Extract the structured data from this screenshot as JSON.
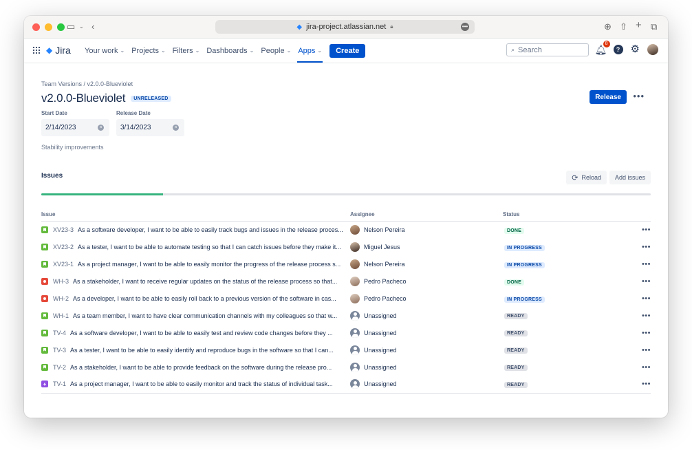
{
  "browser": {
    "url": "jira-project.atlassian.net",
    "lock_icon": "lock-icon"
  },
  "nav": {
    "logo": "Jira",
    "items": [
      {
        "label": "Your work",
        "caret": true
      },
      {
        "label": "Projects",
        "caret": true
      },
      {
        "label": "Filters",
        "caret": true
      },
      {
        "label": "Dashboards",
        "caret": true
      },
      {
        "label": "People",
        "caret": true
      },
      {
        "label": "Apps",
        "caret": true,
        "active": true
      }
    ],
    "create_label": "Create",
    "search_placeholder": "Search",
    "notifications_count": "8"
  },
  "page": {
    "breadcrumb": "Team Versions  /  v2.0.0-Blueviolet",
    "title": "v2.0.0-Blueviolet",
    "release_status": "UNRELEASED",
    "release_button": "Release",
    "start_date_label": "Start Date",
    "start_date": "2/14/2023",
    "release_date_label": "Release Date",
    "release_date": "3/14/2023",
    "description": "Stability improvements",
    "issues_heading": "Issues",
    "reload_label": "Reload",
    "add_issues_label": "Add issues",
    "progress_done_fraction": 0.2
  },
  "table": {
    "headers": {
      "issue": "Issue",
      "assignee": "Assignee",
      "status": "Status"
    },
    "rows": [
      {
        "type": "story",
        "key": "XV23-3",
        "summary": "As a software developer, I want to be able to easily track bugs and issues in the release proces...",
        "assignee": "Nelson Pereira",
        "avatar": "photo-a",
        "status": "DONE",
        "status_kind": "done"
      },
      {
        "type": "story",
        "key": "XV23-2",
        "summary": "As a tester, I want to be able to automate testing so that I can catch issues before they make it...",
        "assignee": "Miguel Jesus",
        "avatar": "photo-b",
        "status": "IN PROGRESS",
        "status_kind": "progress"
      },
      {
        "type": "story",
        "key": "XV23-1",
        "summary": "As a project manager, I want to be able to easily monitor the progress of the release process s...",
        "assignee": "Nelson Pereira",
        "avatar": "photo-a",
        "status": "IN PROGRESS",
        "status_kind": "progress"
      },
      {
        "type": "bug",
        "key": "WH-3",
        "summary": "As a stakeholder, I want to receive regular updates on the status of the release process so that...",
        "assignee": "Pedro Pacheco",
        "avatar": "photo-c",
        "status": "DONE",
        "status_kind": "done"
      },
      {
        "type": "bug",
        "key": "WH-2",
        "summary": "As a developer, I want to be able to easily roll back to a previous version of the software in cas...",
        "assignee": "Pedro Pacheco",
        "avatar": "photo-c",
        "status": "IN PROGRESS",
        "status_kind": "progress"
      },
      {
        "type": "story",
        "key": "WH-1",
        "summary": "As a team member, I want to have clear communication channels with my colleagues so that w...",
        "assignee": "Unassigned",
        "avatar": "empty",
        "status": "READY",
        "status_kind": "ready"
      },
      {
        "type": "story",
        "key": "TV-4",
        "summary": "As a software developer, I want to be able to easily test and review code changes before they ...",
        "assignee": "Unassigned",
        "avatar": "empty",
        "status": "READY",
        "status_kind": "ready"
      },
      {
        "type": "story",
        "key": "TV-3",
        "summary": "As a tester, I want to be able to easily identify and reproduce bugs in the software so that I can...",
        "assignee": "Unassigned",
        "avatar": "empty",
        "status": "READY",
        "status_kind": "ready"
      },
      {
        "type": "story",
        "key": "TV-2",
        "summary": "As a stakeholder, I want to be able to provide feedback on the software during the release pro...",
        "assignee": "Unassigned",
        "avatar": "empty",
        "status": "READY",
        "status_kind": "ready"
      },
      {
        "type": "epic",
        "key": "TV-1",
        "summary": "As a project manager, I want to be able to easily monitor and track the status of individual task...",
        "assignee": "Unassigned",
        "avatar": "empty",
        "status": "READY",
        "status_kind": "ready"
      }
    ]
  },
  "colors": {
    "brand": "#0052cc",
    "done": "#36b37e"
  }
}
